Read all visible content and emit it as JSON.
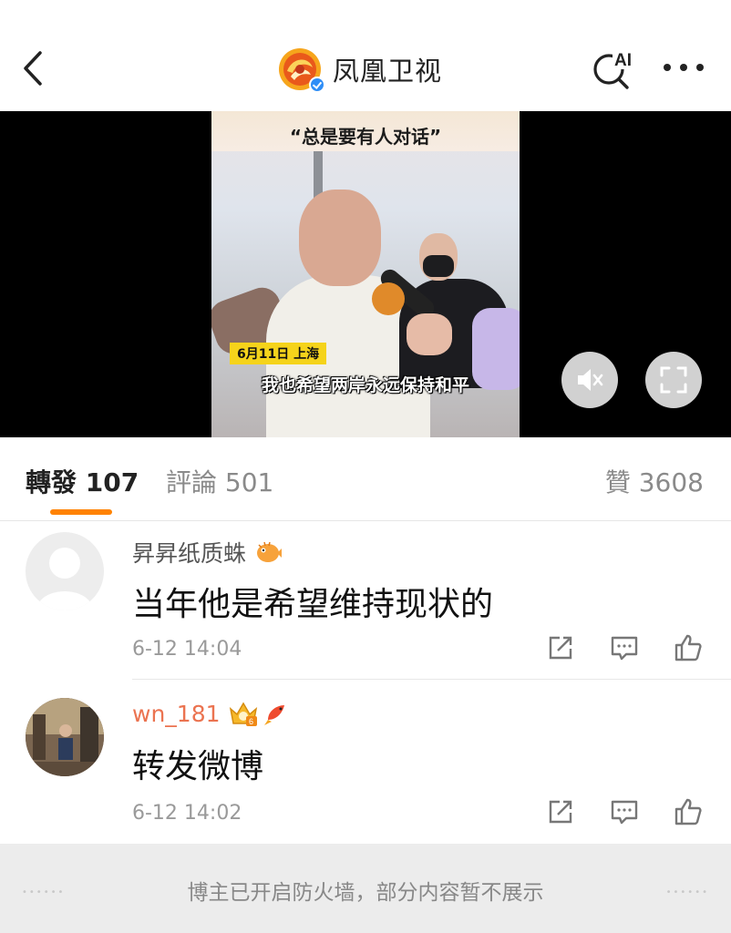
{
  "header": {
    "account_name": "凤凰卫视",
    "ai_badge": "AI"
  },
  "video": {
    "caption_top": "“总是要有人对话”",
    "date_tag": "6月11日 上海",
    "caption_bottom": "我也希望两岸永远保持和平"
  },
  "tabs": {
    "repost_label": "轉發",
    "repost_count": "107",
    "comment_label": "評論",
    "comment_count": "501",
    "like_label": "贊",
    "like_count": "3608"
  },
  "comments": [
    {
      "username": "昇昇纸质蛛",
      "text": "当年他是希望维持现状的",
      "time": "6-12 14:04",
      "name_color": "#555555"
    },
    {
      "username": "wn_181",
      "text": "转发微博",
      "time": "6-12 14:02",
      "name_color": "#eb7350"
    }
  ],
  "footer": {
    "notice": "博主已开启防火墙，部分内容暂不展示"
  },
  "colors": {
    "accent": "#ff8200",
    "verified": "#2f8ef7"
  },
  "icons": [
    "back-arrow-icon",
    "ai-search-icon",
    "more-icon",
    "mute-icon",
    "fullscreen-icon",
    "share-icon",
    "comment-icon",
    "like-icon"
  ]
}
